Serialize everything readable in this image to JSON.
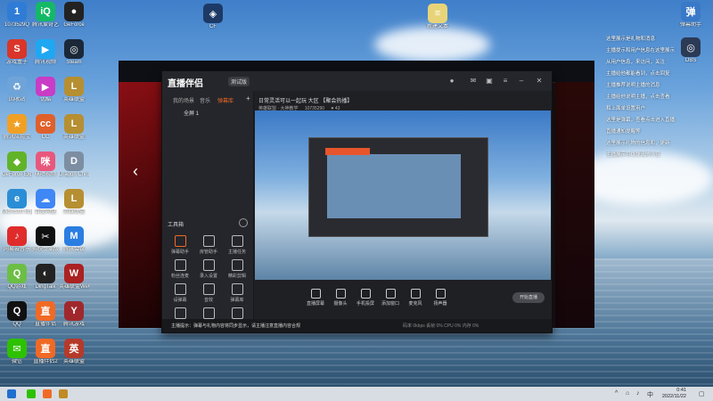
{
  "desktop": {
    "icons": [
      {
        "label": "1073529Q",
        "color": "#2f7cd6",
        "glyph": "1"
      },
      {
        "label": "腾讯爱奇艺",
        "color": "#14b866",
        "glyph": "iQ"
      },
      {
        "label": "GeForce",
        "color": "#222",
        "glyph": "●"
      },
      {
        "label": "游戏盒子",
        "color": "#d9352a",
        "glyph": "S"
      },
      {
        "label": "腾讯视频",
        "color": "#1fa7f2",
        "glyph": "▶"
      },
      {
        "label": "Steam",
        "color": "#1b2838",
        "glyph": "◎"
      },
      {
        "label": "回收站",
        "color": "#6fa4d8",
        "glyph": "♻"
      },
      {
        "label": "优酷",
        "color": "#c83cc6",
        "glyph": "▶"
      },
      {
        "label": "英雄联盟",
        "color": "#b68f32",
        "glyph": "L"
      },
      {
        "label": "腾讯应用宝",
        "color": "#f0a025",
        "glyph": "★"
      },
      {
        "label": "CC",
        "color": "#e0602c",
        "glyph": "cc"
      },
      {
        "label": "英雄联盟",
        "color": "#b68f32",
        "glyph": "L"
      },
      {
        "label": "GeForce Experience",
        "color": "#61b329",
        "glyph": "◆"
      },
      {
        "label": "咪咕视频",
        "color": "#e8587c",
        "glyph": "咪"
      },
      {
        "label": "Dragon Chronicle",
        "color": "#7d8ea3",
        "glyph": "D"
      },
      {
        "label": "Microsoft Edge",
        "color": "#2a8ed6",
        "glyph": "e"
      },
      {
        "label": "百度网盘",
        "color": "#3f87f5",
        "glyph": "☁"
      },
      {
        "label": "英雄联盟",
        "color": "#b68f32",
        "glyph": "L"
      },
      {
        "label": "网易云音乐",
        "color": "#e02b2b",
        "glyph": "♪"
      },
      {
        "label": "剪映专业版",
        "color": "#101010",
        "glyph": "✂"
      },
      {
        "label": "腾讯会议",
        "color": "#2a7de1",
        "glyph": "M"
      },
      {
        "label": "QQ游戏",
        "color": "#6cbe45",
        "glyph": "Q"
      },
      {
        "label": "DingTalk",
        "color": "#222",
        "glyph": "◐"
      },
      {
        "label": "英雄联盟WeGame",
        "color": "#a22",
        "glyph": "W"
      },
      {
        "label": "QQ",
        "color": "#111",
        "glyph": "Q"
      },
      {
        "label": "直播伴侣",
        "color": "#f06a25",
        "glyph": "直"
      },
      {
        "label": "腾讯游戏",
        "color": "#a0282c",
        "glyph": "Y"
      },
      {
        "label": "微信",
        "color": "#2dc100",
        "glyph": "✉"
      },
      {
        "label": "直播伴侣2",
        "color": "#f06a25",
        "glyph": "直"
      },
      {
        "label": "英雄联盟",
        "color": "#b53a2a",
        "glyph": "英"
      }
    ],
    "top_icons": [
      {
        "label": "CF",
        "color": "#1d3a66",
        "glyph": "◈"
      },
      {
        "label": "新建文本",
        "color": "#e8d478",
        "glyph": "≡"
      }
    ],
    "right_icons": [
      {
        "label": "弹幕助手",
        "color": "#3a78c8",
        "glyph": "弹"
      },
      {
        "label": "OBS",
        "color": "#2b3a55",
        "glyph": "◎"
      }
    ]
  },
  "notes": [
    "这里展示是礼物和消息",
    "主播提示和用户信息在这里展示",
    "从用户信息，来访问，关注",
    "主播给他都能看到，点击回复",
    "主播推荐说明主播的消息",
    "主播给他说明主播，点击查看",
    "和上面单设置用户",
    "这里是弹幕，查看点击进入直播",
    "直播通知提醒等",
    "这里展示礼物的信息和，更新",
    "主播展示可以弹出的小窗"
  ],
  "app": {
    "name": "直播伴侣",
    "tag": "测试版",
    "left_tabs": [
      "我的场景",
      "音乐",
      "弹幕库"
    ],
    "scene_label": "全屏 1",
    "tools_title": "工具箱",
    "tools": [
      "弹幕助手",
      "房管助手",
      "主播任务",
      "粉丝连麦",
      "录入设置",
      "精彩剪辑",
      "设弹幕",
      "音效",
      "弹幕库",
      "装饰",
      "下载",
      "更多"
    ],
    "room_title": "日常灵活可以一起玩 大区",
    "room_tag": "【聚会热播】",
    "room_sub": "英雄联盟 · 大神教学",
    "room_id": "10735290",
    "viewer_count": "43",
    "bottom_buttons": [
      "直播屏幕",
      "摄像头",
      "手机投屏",
      "添加窗口",
      "麦克风",
      "扬声器"
    ],
    "live_button": "开始直播",
    "notice": "主播提示：弹幕与礼物内容将同步显示，请主播注意直播内容合规",
    "status_items": [
      "码率 0kbps",
      "丢帧 0%",
      "CPU 0%",
      "内存 0%"
    ]
  },
  "taskbar": {
    "time": "0:41",
    "date": "2022/11/22"
  }
}
